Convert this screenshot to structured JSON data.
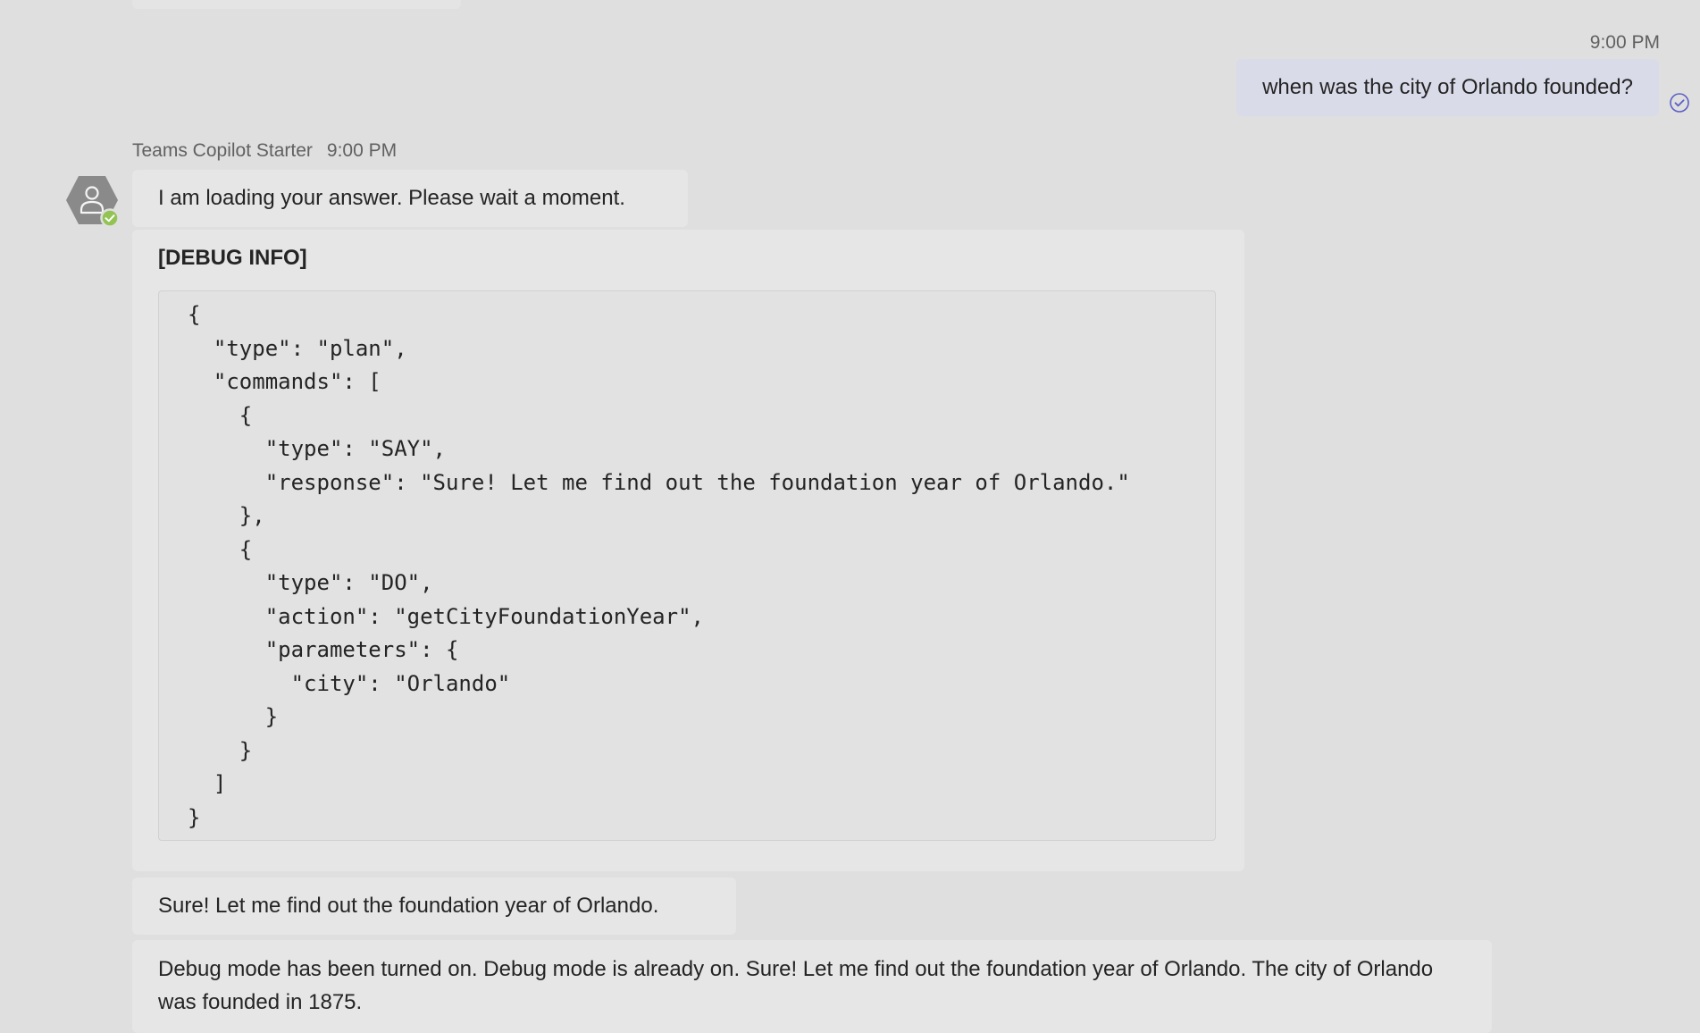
{
  "outgoing": {
    "time": "9:00 PM",
    "message": "when was the city of Orlando founded?",
    "status_icon": "read-receipt-check-icon"
  },
  "bot": {
    "name": "Teams Copilot Starter",
    "time": "9:00 PM",
    "avatar_icon": "bot-avatar-icon",
    "messages": {
      "loading": "I am loading your answer. Please wait a moment.",
      "debug_title": "[DEBUG INFO]",
      "debug_json": "{\n  \"type\": \"plan\",\n  \"commands\": [\n    {\n      \"type\": \"SAY\",\n      \"response\": \"Sure! Let me find out the foundation year of Orlando.\"\n    },\n    {\n      \"type\": \"DO\",\n      \"action\": \"getCityFoundationYear\",\n      \"parameters\": {\n        \"city\": \"Orlando\"\n      }\n    }\n  ]\n}",
      "say_response": "Sure! Let me find out the foundation year of Orlando.",
      "final_answer": "Debug mode has been turned on. Debug mode is already on. Sure! Let me find out the foundation year of Orlando. The city of Orlando was founded in 1875."
    }
  },
  "colors": {
    "background": "#dfdfdf",
    "outgoing_bubble": "#d9dbe9",
    "incoming_bubble": "#e6e6e6",
    "read_receipt": "#5b5fc7",
    "presence_available": "#92c353"
  }
}
